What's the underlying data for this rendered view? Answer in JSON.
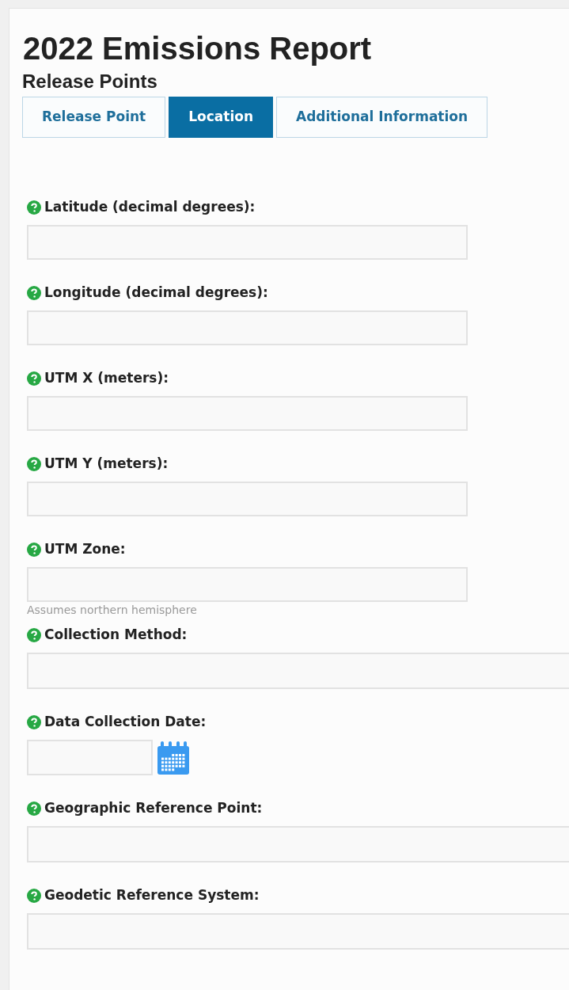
{
  "title": "2022 Emissions Report",
  "subtitle": "Release Points",
  "tabs": [
    {
      "label": "Release Point",
      "selected": false
    },
    {
      "label": "Location",
      "selected": true
    },
    {
      "label": "Additional Information",
      "selected": false
    }
  ],
  "fields": [
    {
      "kind": "text",
      "label": "Latitude (decimal degrees):"
    },
    {
      "kind": "text",
      "label": "Longitude (decimal degrees):"
    },
    {
      "kind": "text",
      "label": "UTM X (meters):"
    },
    {
      "kind": "text",
      "label": "UTM Y (meters):"
    },
    {
      "kind": "text",
      "label": "UTM Zone:",
      "hint": "Assumes northern hemisphere"
    },
    {
      "kind": "select",
      "label": "Collection Method:"
    },
    {
      "kind": "date",
      "label": "Data Collection Date:"
    },
    {
      "kind": "select",
      "label": "Geographic Reference Point:"
    },
    {
      "kind": "select",
      "label": "Geodetic Reference System:"
    }
  ]
}
